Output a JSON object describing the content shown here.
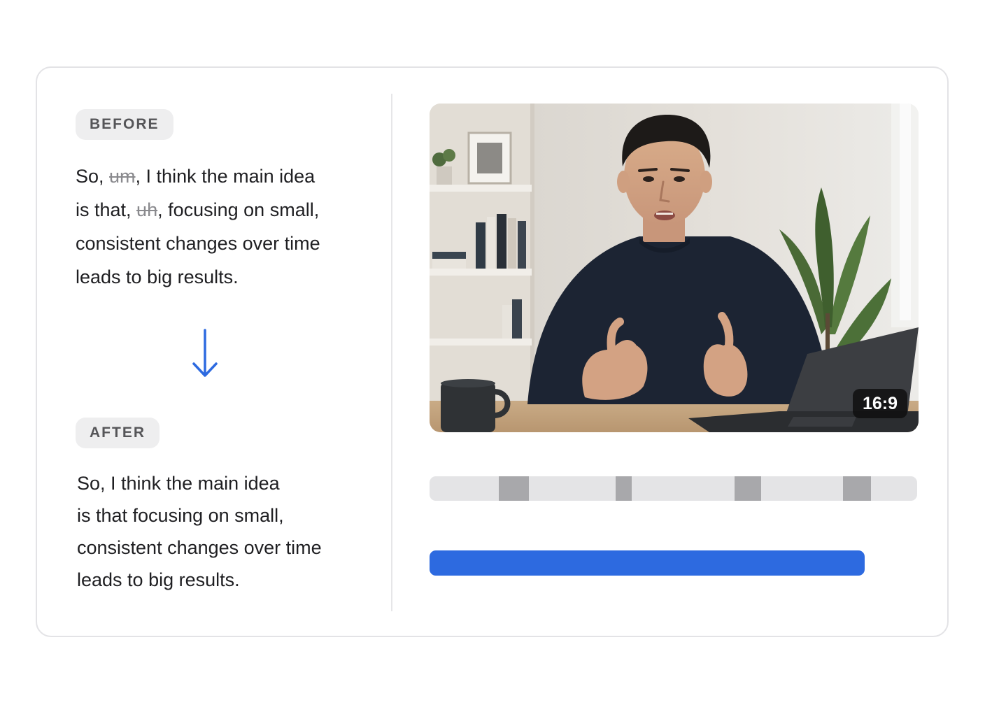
{
  "before": {
    "badge": "BEFORE",
    "lines": [
      {
        "pre": "So, ",
        "filler": "um",
        "post": ", I think the main idea"
      },
      {
        "pre": "is that, ",
        "filler": "uh",
        "post": ", focusing on small,"
      },
      {
        "pre": "consistent changes over time",
        "filler": "",
        "post": ""
      },
      {
        "pre": "leads to big results.",
        "filler": "",
        "post": ""
      }
    ]
  },
  "after": {
    "badge": "AFTER",
    "lines": [
      "So, I think the main idea",
      "is that focusing on small,",
      "consistent changes over time",
      "leads to big results."
    ]
  },
  "video": {
    "aspect_label": "16:9"
  },
  "colors": {
    "accent": "#2d6ae0",
    "cut_segment": "#a8a8ab",
    "track": "#e4e4e6",
    "strike_text": "#8a8a8e"
  },
  "icons": {
    "transform_arrow": "arrow-down-icon"
  }
}
